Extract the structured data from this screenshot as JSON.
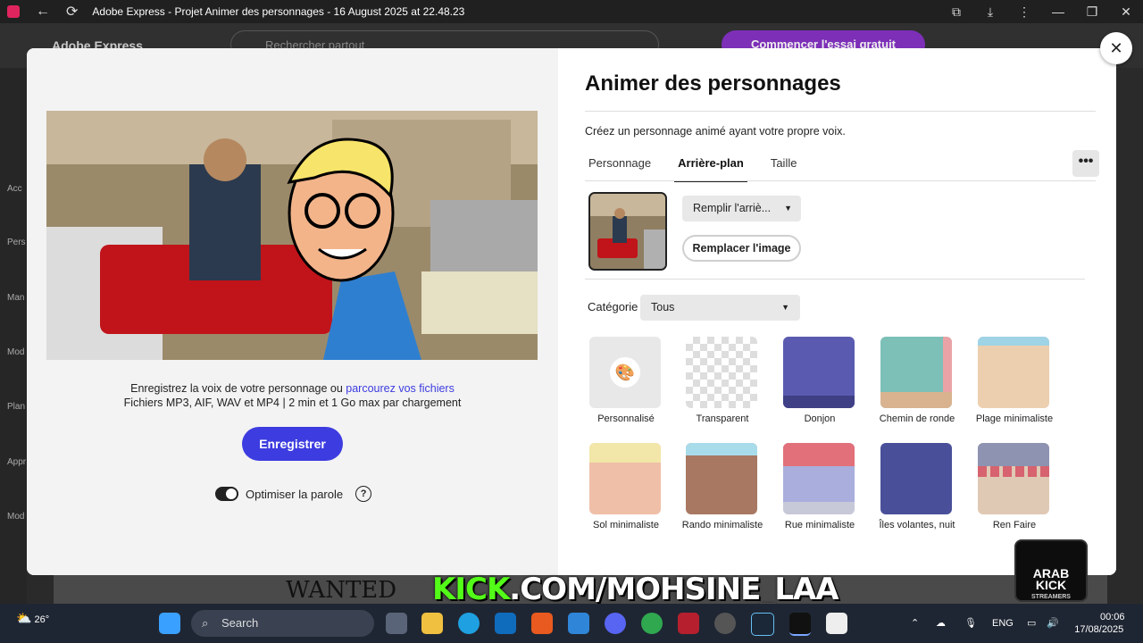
{
  "window": {
    "title": "Adobe Express - Projet Animer des personnages - 16 August 2025 at 22.48.23"
  },
  "background_app": {
    "logo": "Adobe Express",
    "search_placeholder": "Rechercher partout",
    "trial_button": "Commencer l'essai gratuit",
    "sidebar": [
      "Acc",
      "Pers",
      "Man",
      "Mod",
      "Plan",
      "Appr",
      "Mod"
    ],
    "banner_text": "WANTED"
  },
  "modal": {
    "title": "Animer des personnages",
    "subtitle": "Créez un personnage animé ayant votre propre voix.",
    "tabs": [
      {
        "label": "Personnage",
        "active": false
      },
      {
        "label": "Arrière-plan",
        "active": true
      },
      {
        "label": "Taille",
        "active": false
      }
    ],
    "more_label": "•••",
    "fill_dropdown": "Remplir l'arriè...",
    "replace_button": "Remplacer l'image",
    "category_label": "Catégorie",
    "category_value": "Tous",
    "voice_line1": "Enregistrez la voix de votre personnage ou",
    "voice_link": "parcourez vos fichiers",
    "voice_line2": "Fichiers MP3, AIF, WAV et MP4 | 2 min et 1 Go max par chargement",
    "record_button": "Enregistrer",
    "optimize_label": "Optimiser la parole",
    "optimize_on": true,
    "close_label": "✕",
    "backgrounds": [
      {
        "label": "Personnalisé",
        "kind": "custom"
      },
      {
        "label": "Transparent",
        "kind": "transparent"
      },
      {
        "label": "Donjon",
        "kind": "dungeon"
      },
      {
        "label": "Chemin de ronde",
        "kind": "walkway"
      },
      {
        "label": "Plage minimaliste",
        "kind": "beach"
      },
      {
        "label": "Sol minimaliste",
        "kind": "floor"
      },
      {
        "label": "Rando minimaliste",
        "kind": "hike"
      },
      {
        "label": "Rue minimaliste",
        "kind": "street"
      },
      {
        "label": "Îles volantes, nuit",
        "kind": "islands"
      },
      {
        "label": "Ren Faire",
        "kind": "renfaire"
      }
    ]
  },
  "overlay": {
    "kick": "KICK",
    "rest": ".COM/MOHSINE_LAA",
    "logo_line1": "ARAB KICK",
    "logo_line2": "STREAMERS"
  },
  "taskbar": {
    "temperature": "26°",
    "search": "Search",
    "language": "ENG",
    "time": "00:06",
    "date": "17/08/2025"
  }
}
